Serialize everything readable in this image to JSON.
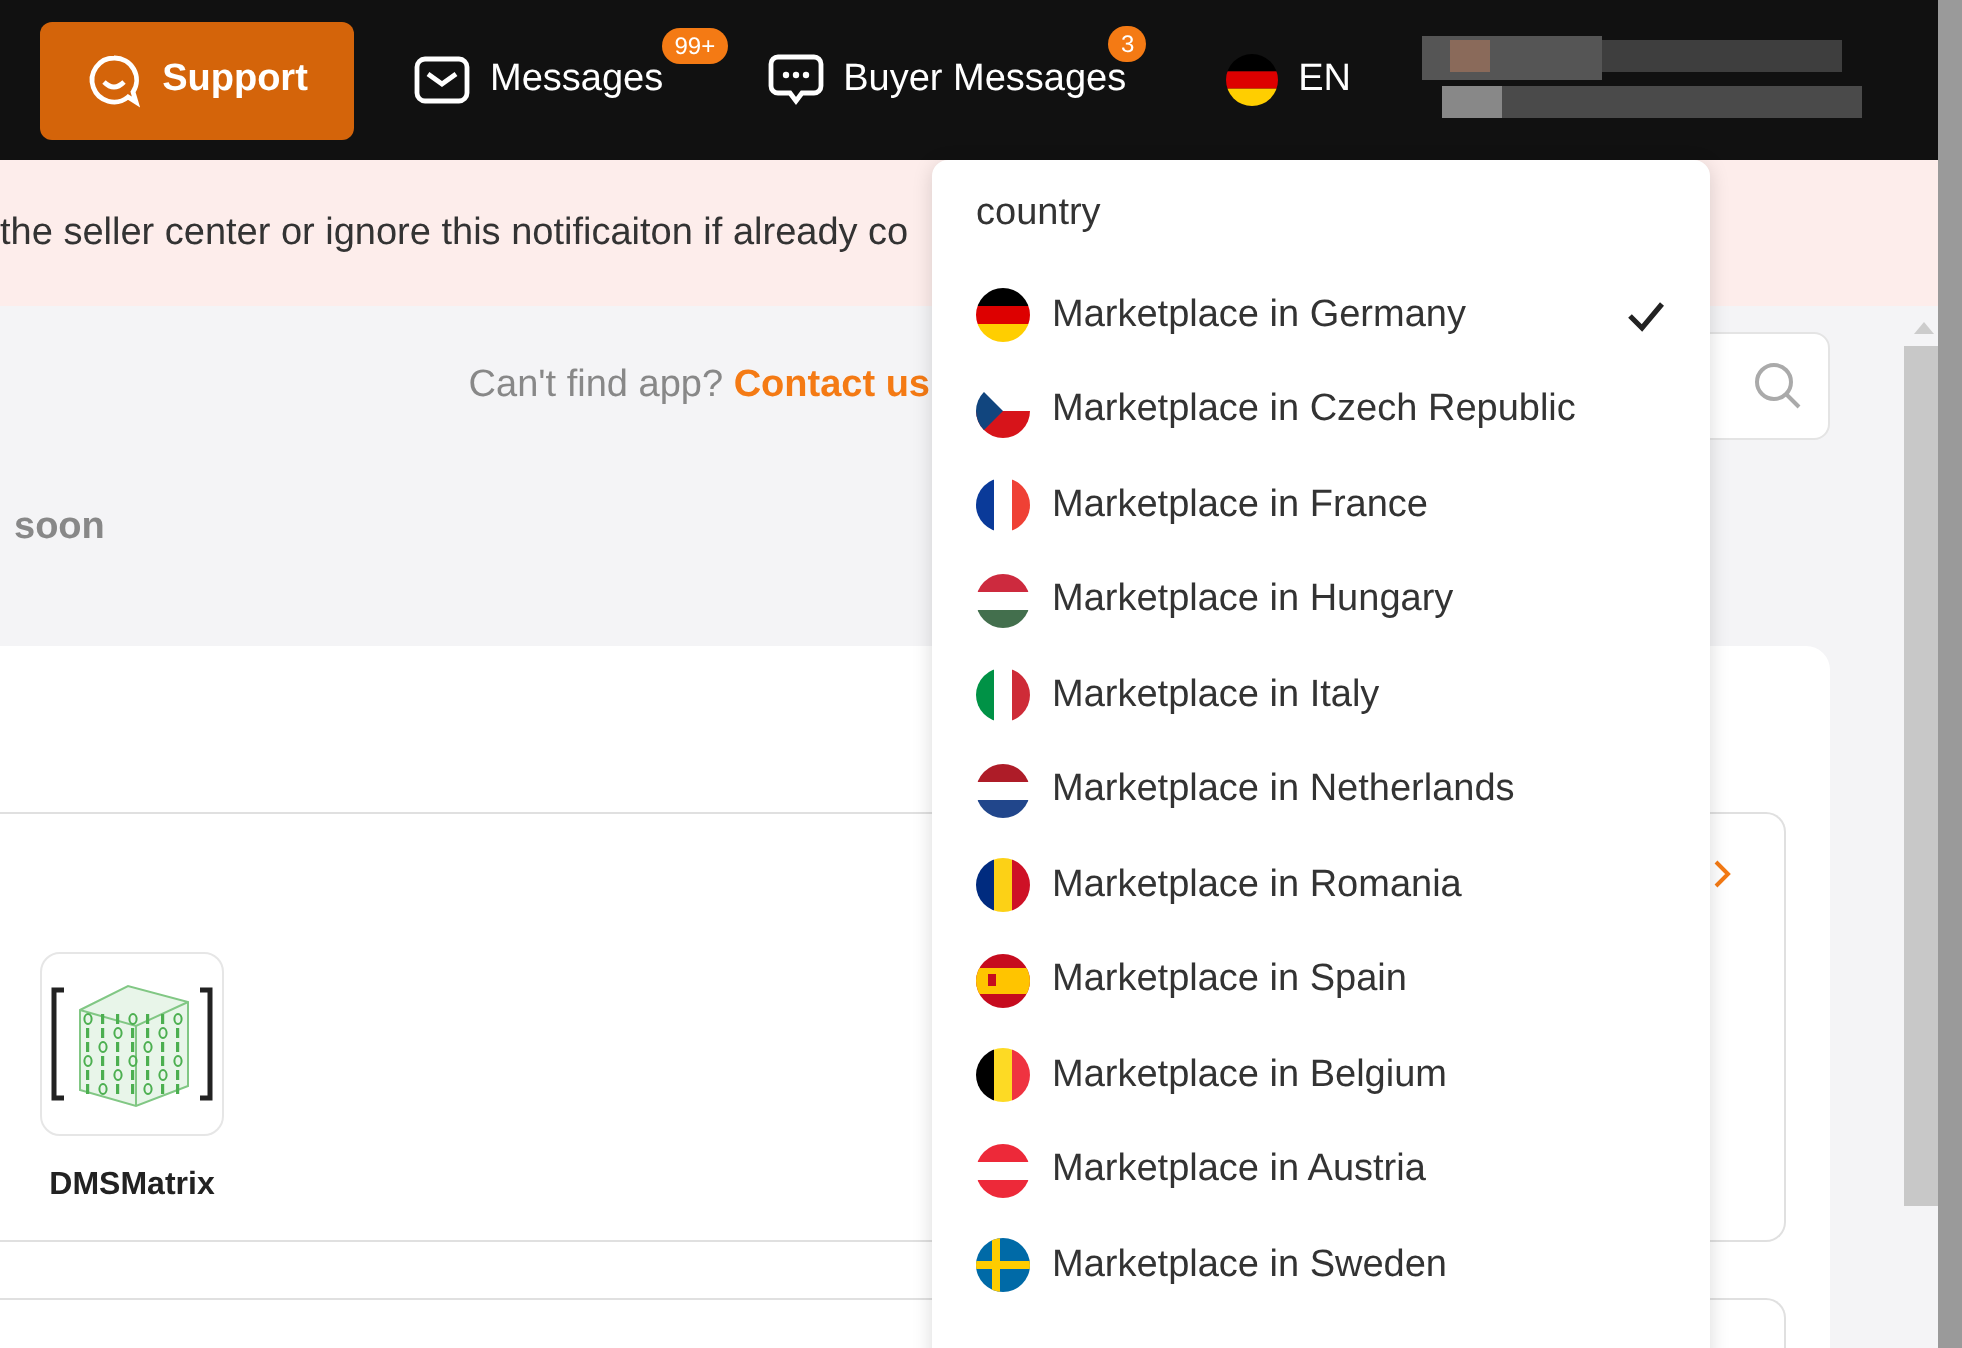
{
  "header": {
    "support": "Support",
    "messages": {
      "label": "Messages",
      "badge": "99+"
    },
    "buyer_messages": {
      "label": "Buyer Messages",
      "badge": "3"
    },
    "language": {
      "label": "EN",
      "kind": "de"
    }
  },
  "notification": "the seller center or ignore this notificaiton if already co",
  "search_hint": {
    "text": "Can't find app?",
    "link": "Contact us"
  },
  "section_note": "soon",
  "apps": [
    {
      "name": "DMSMatrix"
    }
  ],
  "country_menu": {
    "title": "country",
    "items": [
      {
        "label": "Marketplace in Germany",
        "kind": "de",
        "selected": true
      },
      {
        "label": "Marketplace in Czech Republic",
        "kind": "cz",
        "selected": false
      },
      {
        "label": "Marketplace in France",
        "kind": "fr",
        "selected": false
      },
      {
        "label": "Marketplace in Hungary",
        "kind": "hu",
        "selected": false
      },
      {
        "label": "Marketplace in Italy",
        "kind": "it",
        "selected": false
      },
      {
        "label": "Marketplace in Netherlands",
        "kind": "nl",
        "selected": false
      },
      {
        "label": "Marketplace in Romania",
        "kind": "ro",
        "selected": false
      },
      {
        "label": "Marketplace in Spain",
        "kind": "es",
        "selected": false
      },
      {
        "label": "Marketplace in Belgium",
        "kind": "be",
        "selected": false
      },
      {
        "label": "Marketplace in Austria",
        "kind": "at",
        "selected": false
      },
      {
        "label": "Marketplace in Sweden",
        "kind": "se",
        "selected": false
      }
    ]
  }
}
